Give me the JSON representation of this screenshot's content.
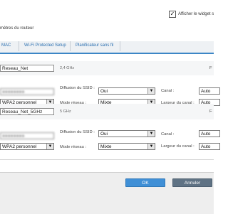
{
  "header": {
    "show_widget_checkbox_label": "Afficher le widget s",
    "show_widget_checked": true,
    "section_title": "mètres du routeur"
  },
  "tabs": [
    {
      "label": "MAC"
    },
    {
      "label": "Wi-Fi Protected Setup"
    },
    {
      "label": "Planificateur sans fil"
    }
  ],
  "bands": [
    {
      "network_name": "Reseau_Net",
      "frequency": "2,4 GHz",
      "ssid_broadcast_label": "Diffusion du SSID :",
      "ssid_broadcast_value": "Oui",
      "network_mode_label": "Mode réseau :",
      "network_mode_value": "Mixte",
      "channel_label": "Canal :",
      "channel_value": "Auto",
      "channel_width_label": "Largeur du canal :",
      "channel_width_value": "Auto",
      "security_value": "WPA2 personnel",
      "right_letter": "F"
    },
    {
      "network_name": "Reseau_Net_5GHz",
      "frequency": "5 GHz",
      "ssid_broadcast_label": "Diffusion du SSID :",
      "ssid_broadcast_value": "Oui",
      "network_mode_label": "Mode réseau :",
      "network_mode_value": "Mixte",
      "channel_label": "Canal :",
      "channel_value": "Auto",
      "channel_width_label": "Largeur du canal :",
      "channel_width_value": "Auto",
      "security_value": "WPA2 personnel",
      "right_letter": "F"
    }
  ],
  "footer": {
    "ok_label": "OK",
    "cancel_label": "Annuler"
  },
  "colors": {
    "accent": "#3c86c6",
    "ok_button": "#3f8fd6",
    "cancel_button": "#5f7284"
  }
}
